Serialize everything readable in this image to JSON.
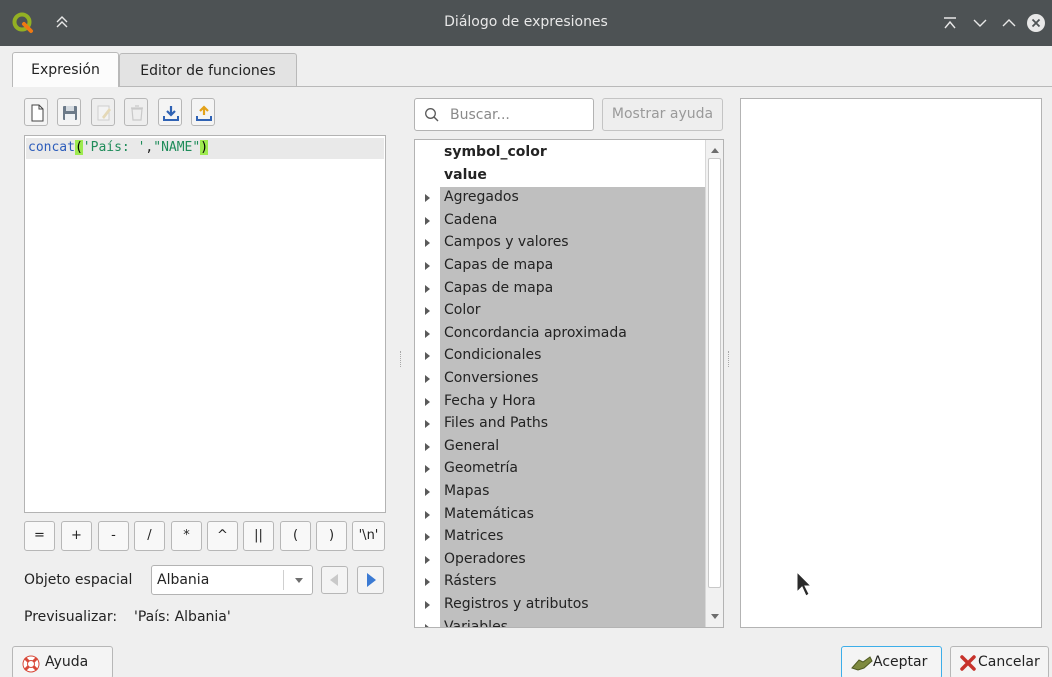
{
  "window": {
    "title": "Diálogo de expresiones"
  },
  "tabs": [
    {
      "label": "Expresión",
      "active": true
    },
    {
      "label": "Editor de funciones",
      "active": false
    }
  ],
  "toolbar": {
    "buttons": [
      {
        "icon": "new-file-icon",
        "enabled": true
      },
      {
        "icon": "save-icon",
        "enabled": true
      },
      {
        "icon": "edit-icon",
        "enabled": false
      },
      {
        "icon": "delete-icon",
        "enabled": false
      },
      {
        "icon": "import-icon",
        "enabled": true
      },
      {
        "icon": "export-icon",
        "enabled": true
      }
    ]
  },
  "editor": {
    "tokens": {
      "fn": "concat",
      "open": "(",
      "str1": "'País: '",
      "comma": ",",
      "str2": "\"NAME\"",
      "close": ")"
    }
  },
  "operators": [
    "=",
    "+",
    "-",
    "/",
    "*",
    "^",
    "||",
    "(",
    ")",
    "'\\n'"
  ],
  "feature": {
    "label": "Objeto espacial",
    "value": "Albania"
  },
  "preview": {
    "label": "Previsualizar:",
    "value": "'País: Albania'"
  },
  "search": {
    "placeholder": "Buscar..."
  },
  "show_help_label": "Mostrar ayuda",
  "function_tree": {
    "items": [
      {
        "label": "symbol_color",
        "type": "variable"
      },
      {
        "label": "value",
        "type": "variable"
      },
      {
        "label": "Agregados",
        "type": "group"
      },
      {
        "label": "Cadena",
        "type": "group"
      },
      {
        "label": "Campos y valores",
        "type": "group"
      },
      {
        "label": "Capas de mapa",
        "type": "group"
      },
      {
        "label": "Capas de mapa",
        "type": "group"
      },
      {
        "label": "Color",
        "type": "group"
      },
      {
        "label": "Concordancia aproximada",
        "type": "group"
      },
      {
        "label": "Condicionales",
        "type": "group"
      },
      {
        "label": "Conversiones",
        "type": "group"
      },
      {
        "label": "Fecha y Hora",
        "type": "group"
      },
      {
        "label": "Files and Paths",
        "type": "group"
      },
      {
        "label": "General",
        "type": "group"
      },
      {
        "label": "Geometría",
        "type": "group"
      },
      {
        "label": "Mapas",
        "type": "group"
      },
      {
        "label": "Matemáticas",
        "type": "group"
      },
      {
        "label": "Matrices",
        "type": "group"
      },
      {
        "label": "Operadores",
        "type": "group"
      },
      {
        "label": "Rásters",
        "type": "group"
      },
      {
        "label": "Registros y atributos",
        "type": "group"
      },
      {
        "label": "Variables",
        "type": "group"
      }
    ]
  },
  "buttons": {
    "help": "Ayuda",
    "ok": "Aceptar",
    "cancel": "Cancelar"
  },
  "colors": {
    "titlebar": "#4d5254",
    "group_highlight": "#bfbfbf",
    "paren_match": "#9dea4f",
    "function_token": "#2d5dbb",
    "string_token": "#1f8c5a"
  }
}
